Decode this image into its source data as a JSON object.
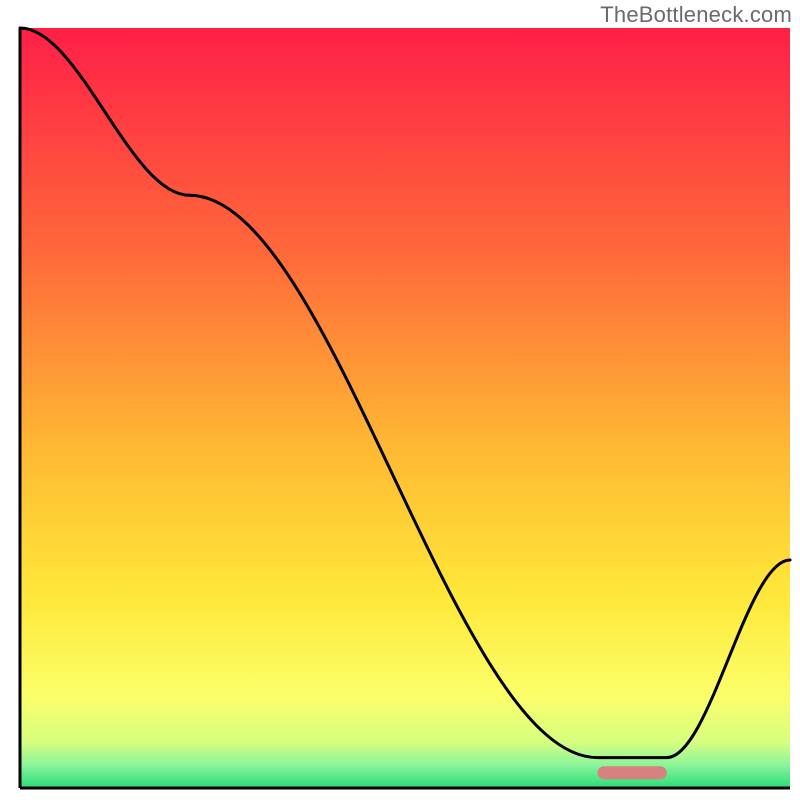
{
  "watermark": "TheBottleneck.com",
  "chart_data": {
    "type": "line",
    "title": "",
    "xlabel": "",
    "ylabel": "",
    "ylim": [
      0,
      100
    ],
    "xlim": [
      0,
      100
    ],
    "legend": false,
    "grid": false,
    "series": [
      {
        "name": "bottleneck-curve",
        "x": [
          0,
          22,
          75,
          84,
          100
        ],
        "y": [
          100,
          78,
          4,
          4,
          30
        ]
      }
    ],
    "marker": {
      "name": "optimum-range",
      "x_center": 79.5,
      "x_width": 9,
      "y": 2,
      "color": "#d9817f"
    },
    "background_gradient": [
      {
        "offset": 0,
        "color": "#ff1f47"
      },
      {
        "offset": 30,
        "color": "#ff6a3a"
      },
      {
        "offset": 55,
        "color": "#ffb833"
      },
      {
        "offset": 75,
        "color": "#ffe83a"
      },
      {
        "offset": 88,
        "color": "#fbff6a"
      },
      {
        "offset": 94,
        "color": "#d6ff80"
      },
      {
        "offset": 97,
        "color": "#8bf49a"
      },
      {
        "offset": 100,
        "color": "#2bdc7a"
      }
    ],
    "colors": {
      "line": "#000000",
      "axis": "#000000"
    }
  }
}
